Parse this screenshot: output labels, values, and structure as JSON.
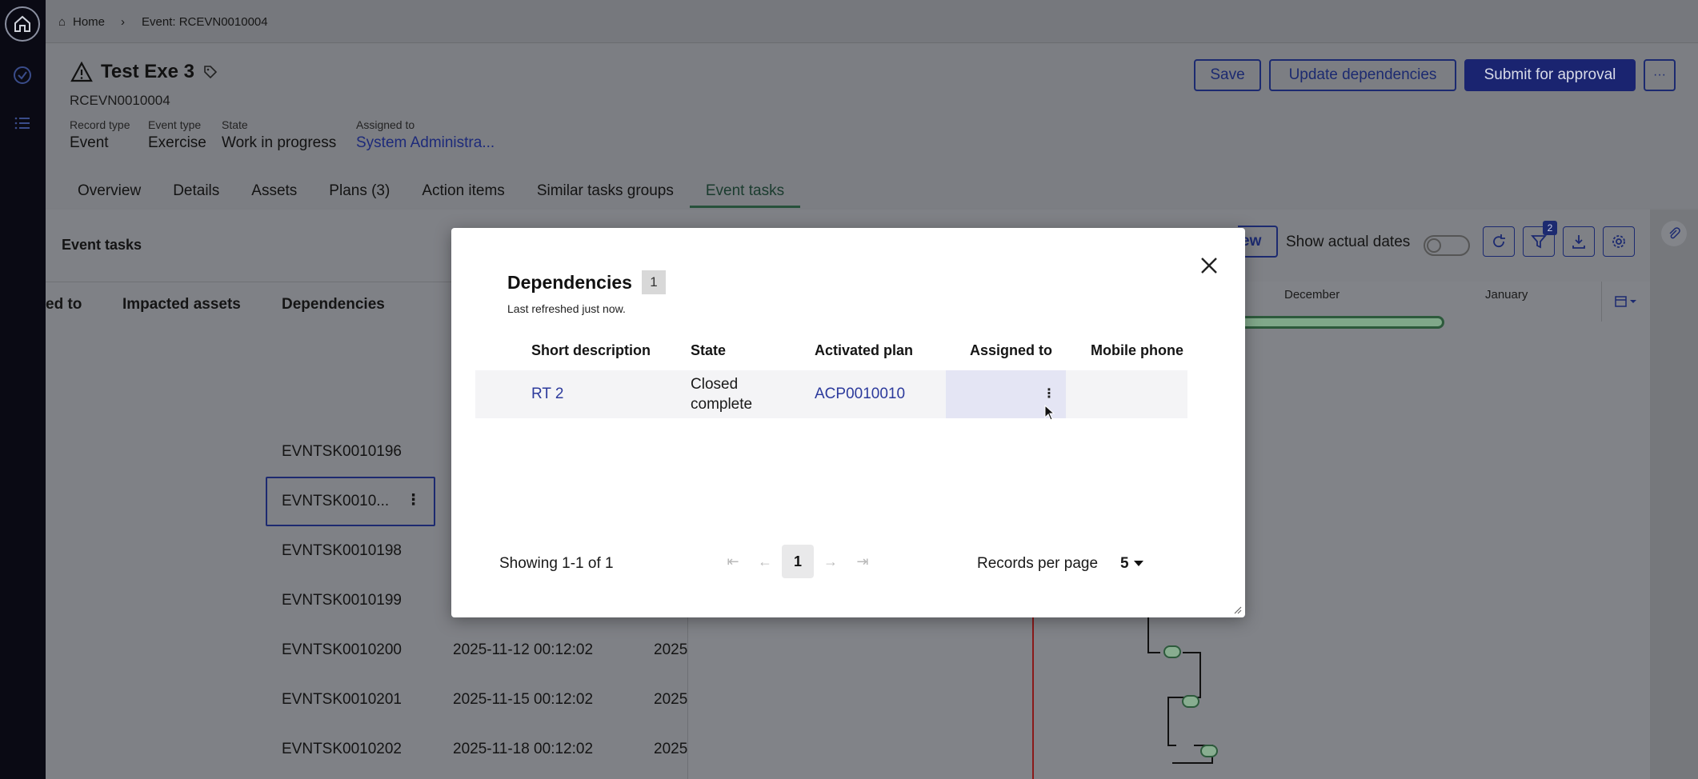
{
  "breadcrumb": {
    "home": "Home",
    "current": "Event: RCEVN0010004"
  },
  "record": {
    "title": "Test Exe 3",
    "number": "RCEVN0010004",
    "fields": [
      {
        "label": "Record type",
        "value": "Event"
      },
      {
        "label": "Event type",
        "value": "Exercise"
      },
      {
        "label": "State",
        "value": "Work in progress"
      },
      {
        "label": "Assigned to",
        "value": "System Administra..."
      }
    ]
  },
  "actions": {
    "save": "Save",
    "update": "Update dependencies",
    "submit": "Submit for approval",
    "more": "···"
  },
  "tabs": [
    "Overview",
    "Details",
    "Assets",
    "Plans (3)",
    "Action items",
    "Similar tasks groups",
    "Event tasks"
  ],
  "event_tasks": {
    "label": "Event tasks",
    "show_actual_dates": "Show actual dates",
    "view_btn_fragment": "ew",
    "filter_count": "2",
    "columns": [
      "ed to",
      "Impacted assets",
      "Dependencies"
    ],
    "gantt_months": [
      "December",
      "January"
    ],
    "rows": [
      {
        "dep": "EVNTSK0010196",
        "start": "",
        "end": ""
      },
      {
        "dep": "EVNTSK0010...",
        "start": "",
        "end": ""
      },
      {
        "dep": "EVNTSK0010198",
        "start": "",
        "end": ""
      },
      {
        "dep": "EVNTSK0010199",
        "start": "",
        "end": ""
      },
      {
        "dep": "EVNTSK0010200",
        "start": "2025-11-12 00:12:02",
        "end": "2025"
      },
      {
        "dep": "EVNTSK0010201",
        "start": "2025-11-15 00:12:02",
        "end": "2025"
      },
      {
        "dep": "EVNTSK0010202",
        "start": "2025-11-18 00:12:02",
        "end": "2025"
      }
    ]
  },
  "modal": {
    "title": "Dependencies",
    "count": "1",
    "subtitle": "Last refreshed just now.",
    "headers": [
      "Short description",
      "State",
      "Activated plan",
      "Assigned to",
      "Mobile phone"
    ],
    "row": {
      "short_description": "RT 2",
      "state_line1": "Closed",
      "state_line2": "complete",
      "activated_plan": "ACP0010010",
      "assigned_to": "",
      "mobile_phone": ""
    },
    "showing": "Showing 1-1 of 1",
    "page": "1",
    "records_per_page_label": "Records per page",
    "records_per_page": "5"
  },
  "colors": {
    "primary": "#1a2470",
    "link": "#2c3a9c",
    "active_tab": "#27513b"
  }
}
